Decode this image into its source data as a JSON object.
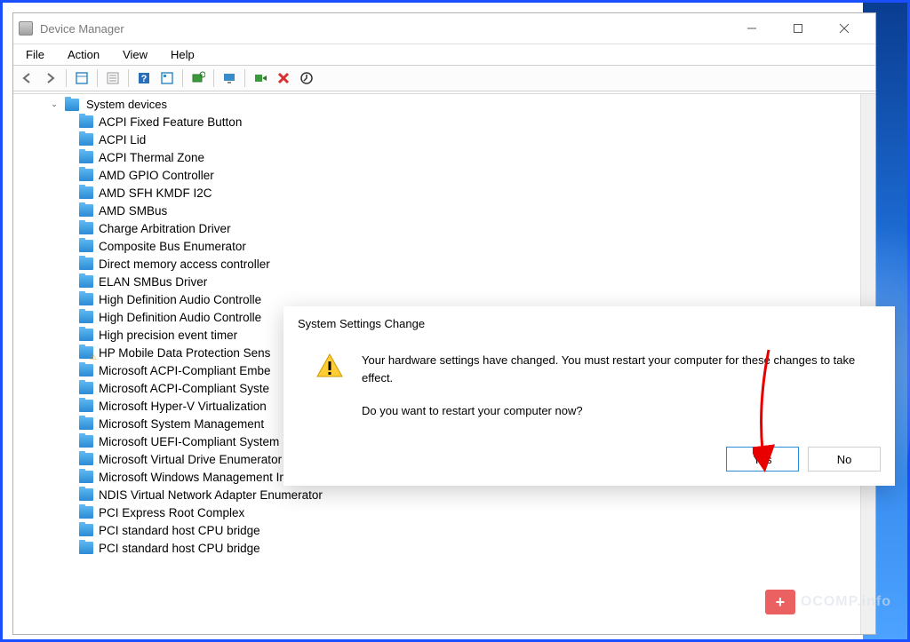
{
  "window": {
    "title": "Device Manager"
  },
  "menu": {
    "file": "File",
    "action": "Action",
    "view": "View",
    "help": "Help"
  },
  "toolbar_icons": {
    "back": "back-arrow-icon",
    "forward": "forward-arrow-icon",
    "up": "folder-up-icon",
    "properties": "properties-icon",
    "help": "help-icon",
    "refresh": "refresh-icon",
    "scan": "scan-hardware-icon",
    "monitor": "monitor-icon",
    "enable": "enable-device-icon",
    "delete": "delete-icon",
    "update": "update-driver-icon"
  },
  "tree": {
    "root": "System devices",
    "items": [
      "ACPI Fixed Feature Button",
      "ACPI Lid",
      "ACPI Thermal Zone",
      "AMD GPIO Controller",
      "AMD SFH KMDF I2C",
      "AMD SMBus",
      "Charge Arbitration Driver",
      "Composite Bus Enumerator",
      "Direct memory access controller",
      "ELAN SMBus Driver",
      "High Definition Audio Controlle",
      "High Definition Audio Controlle",
      "High precision event timer",
      "HP Mobile Data Protection Sens",
      "Microsoft ACPI-Compliant Embe",
      "Microsoft ACPI-Compliant Syste",
      "Microsoft Hyper-V Virtualization",
      "Microsoft System Management",
      "Microsoft UEFI-Compliant System",
      "Microsoft Virtual Drive Enumerator",
      "Microsoft Windows Management Interface for ACPI",
      "NDIS Virtual Network Adapter Enumerator",
      "PCI Express Root Complex",
      "PCI standard host CPU bridge",
      "PCI standard host CPU bridge"
    ],
    "warn_index": 13
  },
  "dialog": {
    "title": "System Settings Change",
    "message": "Your hardware settings have changed. You must restart your computer for these changes to take effect.",
    "question": "Do you want to restart your computer now?",
    "yes": "Yes",
    "no": "No"
  },
  "watermark": {
    "text": "OCOMP.info"
  }
}
